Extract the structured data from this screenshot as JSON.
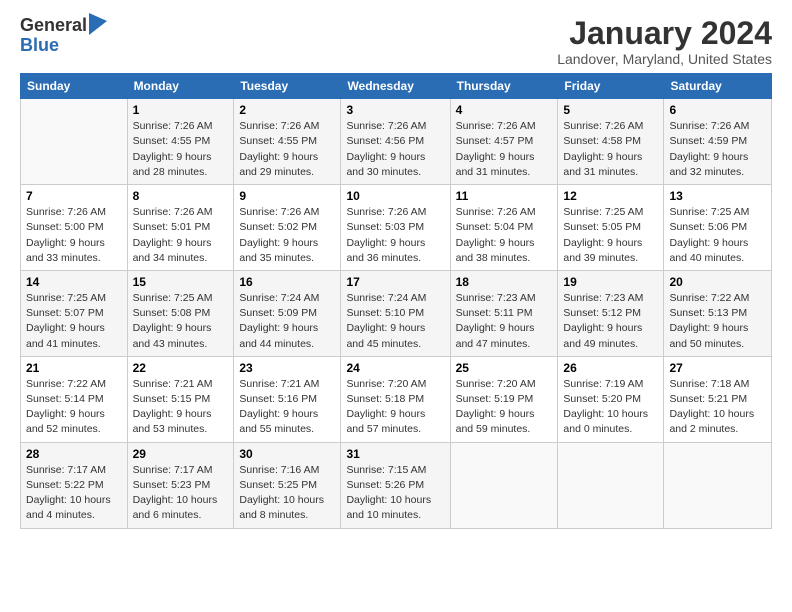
{
  "logo": {
    "general": "General",
    "blue": "Blue"
  },
  "title": "January 2024",
  "location": "Landover, Maryland, United States",
  "headers": [
    "Sunday",
    "Monday",
    "Tuesday",
    "Wednesday",
    "Thursday",
    "Friday",
    "Saturday"
  ],
  "weeks": [
    [
      {
        "day": "",
        "info": ""
      },
      {
        "day": "1",
        "info": "Sunrise: 7:26 AM\nSunset: 4:55 PM\nDaylight: 9 hours\nand 28 minutes."
      },
      {
        "day": "2",
        "info": "Sunrise: 7:26 AM\nSunset: 4:55 PM\nDaylight: 9 hours\nand 29 minutes."
      },
      {
        "day": "3",
        "info": "Sunrise: 7:26 AM\nSunset: 4:56 PM\nDaylight: 9 hours\nand 30 minutes."
      },
      {
        "day": "4",
        "info": "Sunrise: 7:26 AM\nSunset: 4:57 PM\nDaylight: 9 hours\nand 31 minutes."
      },
      {
        "day": "5",
        "info": "Sunrise: 7:26 AM\nSunset: 4:58 PM\nDaylight: 9 hours\nand 31 minutes."
      },
      {
        "day": "6",
        "info": "Sunrise: 7:26 AM\nSunset: 4:59 PM\nDaylight: 9 hours\nand 32 minutes."
      }
    ],
    [
      {
        "day": "7",
        "info": "Sunrise: 7:26 AM\nSunset: 5:00 PM\nDaylight: 9 hours\nand 33 minutes."
      },
      {
        "day": "8",
        "info": "Sunrise: 7:26 AM\nSunset: 5:01 PM\nDaylight: 9 hours\nand 34 minutes."
      },
      {
        "day": "9",
        "info": "Sunrise: 7:26 AM\nSunset: 5:02 PM\nDaylight: 9 hours\nand 35 minutes."
      },
      {
        "day": "10",
        "info": "Sunrise: 7:26 AM\nSunset: 5:03 PM\nDaylight: 9 hours\nand 36 minutes."
      },
      {
        "day": "11",
        "info": "Sunrise: 7:26 AM\nSunset: 5:04 PM\nDaylight: 9 hours\nand 38 minutes."
      },
      {
        "day": "12",
        "info": "Sunrise: 7:25 AM\nSunset: 5:05 PM\nDaylight: 9 hours\nand 39 minutes."
      },
      {
        "day": "13",
        "info": "Sunrise: 7:25 AM\nSunset: 5:06 PM\nDaylight: 9 hours\nand 40 minutes."
      }
    ],
    [
      {
        "day": "14",
        "info": "Sunrise: 7:25 AM\nSunset: 5:07 PM\nDaylight: 9 hours\nand 41 minutes."
      },
      {
        "day": "15",
        "info": "Sunrise: 7:25 AM\nSunset: 5:08 PM\nDaylight: 9 hours\nand 43 minutes."
      },
      {
        "day": "16",
        "info": "Sunrise: 7:24 AM\nSunset: 5:09 PM\nDaylight: 9 hours\nand 44 minutes."
      },
      {
        "day": "17",
        "info": "Sunrise: 7:24 AM\nSunset: 5:10 PM\nDaylight: 9 hours\nand 45 minutes."
      },
      {
        "day": "18",
        "info": "Sunrise: 7:23 AM\nSunset: 5:11 PM\nDaylight: 9 hours\nand 47 minutes."
      },
      {
        "day": "19",
        "info": "Sunrise: 7:23 AM\nSunset: 5:12 PM\nDaylight: 9 hours\nand 49 minutes."
      },
      {
        "day": "20",
        "info": "Sunrise: 7:22 AM\nSunset: 5:13 PM\nDaylight: 9 hours\nand 50 minutes."
      }
    ],
    [
      {
        "day": "21",
        "info": "Sunrise: 7:22 AM\nSunset: 5:14 PM\nDaylight: 9 hours\nand 52 minutes."
      },
      {
        "day": "22",
        "info": "Sunrise: 7:21 AM\nSunset: 5:15 PM\nDaylight: 9 hours\nand 53 minutes."
      },
      {
        "day": "23",
        "info": "Sunrise: 7:21 AM\nSunset: 5:16 PM\nDaylight: 9 hours\nand 55 minutes."
      },
      {
        "day": "24",
        "info": "Sunrise: 7:20 AM\nSunset: 5:18 PM\nDaylight: 9 hours\nand 57 minutes."
      },
      {
        "day": "25",
        "info": "Sunrise: 7:20 AM\nSunset: 5:19 PM\nDaylight: 9 hours\nand 59 minutes."
      },
      {
        "day": "26",
        "info": "Sunrise: 7:19 AM\nSunset: 5:20 PM\nDaylight: 10 hours\nand 0 minutes."
      },
      {
        "day": "27",
        "info": "Sunrise: 7:18 AM\nSunset: 5:21 PM\nDaylight: 10 hours\nand 2 minutes."
      }
    ],
    [
      {
        "day": "28",
        "info": "Sunrise: 7:17 AM\nSunset: 5:22 PM\nDaylight: 10 hours\nand 4 minutes."
      },
      {
        "day": "29",
        "info": "Sunrise: 7:17 AM\nSunset: 5:23 PM\nDaylight: 10 hours\nand 6 minutes."
      },
      {
        "day": "30",
        "info": "Sunrise: 7:16 AM\nSunset: 5:25 PM\nDaylight: 10 hours\nand 8 minutes."
      },
      {
        "day": "31",
        "info": "Sunrise: 7:15 AM\nSunset: 5:26 PM\nDaylight: 10 hours\nand 10 minutes."
      },
      {
        "day": "",
        "info": ""
      },
      {
        "day": "",
        "info": ""
      },
      {
        "day": "",
        "info": ""
      }
    ]
  ]
}
